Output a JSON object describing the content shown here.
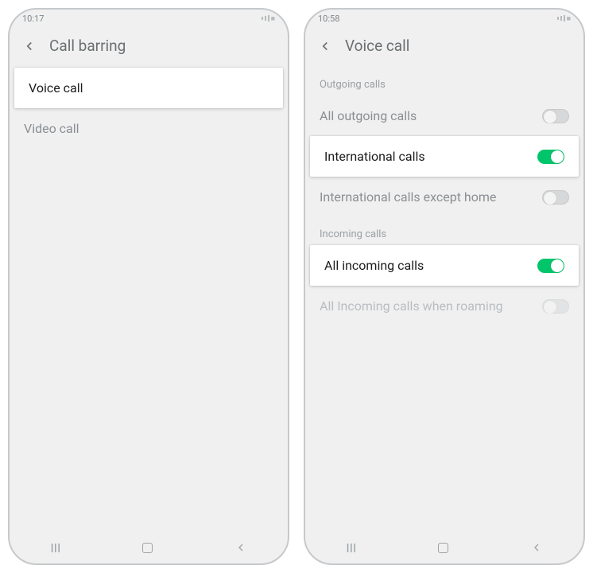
{
  "left": {
    "status_time": "10:17",
    "header": {
      "title": "Call barring"
    },
    "items": [
      {
        "label": "Voice call",
        "highlighted": true
      },
      {
        "label": "Video call",
        "highlighted": false
      }
    ]
  },
  "right": {
    "status_time": "10:58",
    "header": {
      "title": "Voice call"
    },
    "sections": [
      {
        "label": "Outgoing calls",
        "rows": [
          {
            "label": "All outgoing calls",
            "toggle": "off",
            "highlighted": false
          },
          {
            "label": "International calls",
            "toggle": "on",
            "highlighted": true
          },
          {
            "label": "International calls except home",
            "toggle": "off",
            "highlighted": false
          }
        ]
      },
      {
        "label": "Incoming calls",
        "rows": [
          {
            "label": "All incoming calls",
            "toggle": "on",
            "highlighted": true
          },
          {
            "label": "All Incoming calls when roaming",
            "toggle": "off",
            "highlighted": false,
            "disabled": true
          }
        ]
      }
    ]
  }
}
